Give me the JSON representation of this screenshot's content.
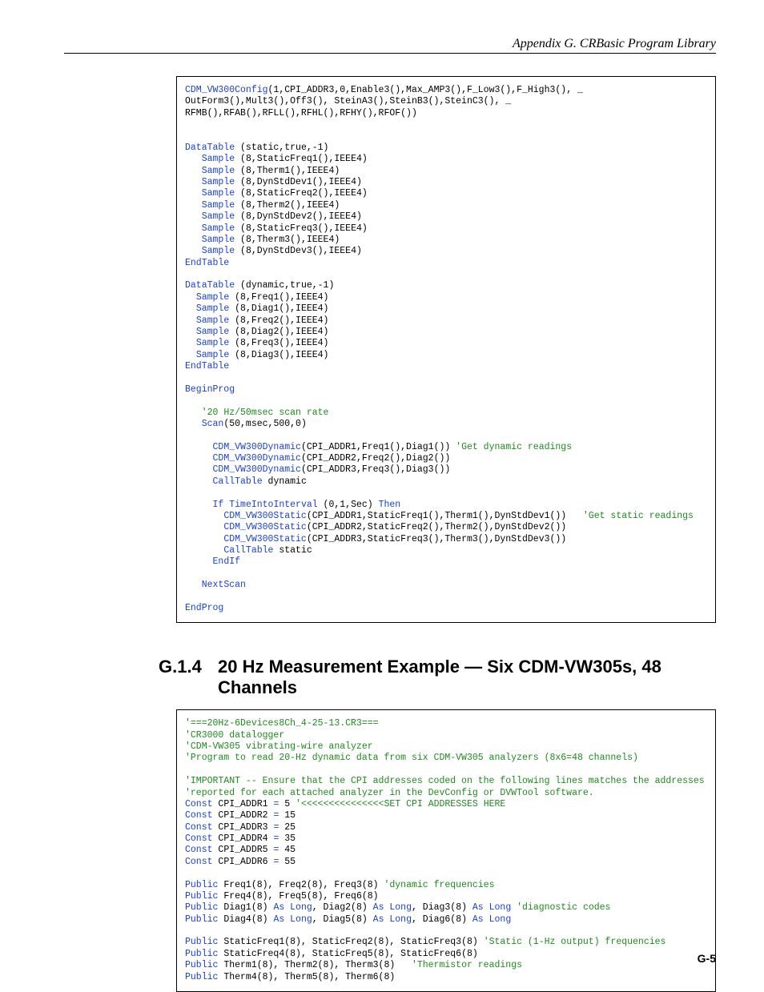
{
  "runningHead": "Appendix G.  CRBasic Program Library",
  "pageNumber": "G-5",
  "section": {
    "number": "G.1.4",
    "title": "20 Hz Measurement Example — Six CDM-VW305s, 48 Channels"
  },
  "code1": [
    [
      [
        "kw",
        "CDM_VW300Config"
      ],
      [
        "plain",
        "(1,CPI_ADDR3,0,Enable3(),Max_AMP3(),F_Low3(),F_High3(), _"
      ]
    ],
    [
      [
        "plain",
        "OutForm3(),Mult3(),Off3(), SteinA3(),SteinB3(),SteinC3(), _"
      ]
    ],
    [
      [
        "plain",
        "RFMB(),RFAB(),RFLL(),RFHL(),RFHY(),RFOF())"
      ]
    ],
    [],
    [],
    [
      [
        "kw",
        "DataTable"
      ],
      [
        "plain",
        " (static,true,-1)"
      ]
    ],
    [
      [
        "plain",
        "   "
      ],
      [
        "kw",
        "Sample"
      ],
      [
        "plain",
        " (8,StaticFreq1(),IEEE4)"
      ]
    ],
    [
      [
        "plain",
        "   "
      ],
      [
        "kw",
        "Sample"
      ],
      [
        "plain",
        " (8,Therm1(),IEEE4)"
      ]
    ],
    [
      [
        "plain",
        "   "
      ],
      [
        "kw",
        "Sample"
      ],
      [
        "plain",
        " (8,DynStdDev1(),IEEE4)"
      ]
    ],
    [
      [
        "plain",
        "   "
      ],
      [
        "kw",
        "Sample"
      ],
      [
        "plain",
        " (8,StaticFreq2(),IEEE4)"
      ]
    ],
    [
      [
        "plain",
        "   "
      ],
      [
        "kw",
        "Sample"
      ],
      [
        "plain",
        " (8,Therm2(),IEEE4)"
      ]
    ],
    [
      [
        "plain",
        "   "
      ],
      [
        "kw",
        "Sample"
      ],
      [
        "plain",
        " (8,DynStdDev2(),IEEE4)"
      ]
    ],
    [
      [
        "plain",
        "   "
      ],
      [
        "kw",
        "Sample"
      ],
      [
        "plain",
        " (8,StaticFreq3(),IEEE4)"
      ]
    ],
    [
      [
        "plain",
        "   "
      ],
      [
        "kw",
        "Sample"
      ],
      [
        "plain",
        " (8,Therm3(),IEEE4)"
      ]
    ],
    [
      [
        "plain",
        "   "
      ],
      [
        "kw",
        "Sample"
      ],
      [
        "plain",
        " (8,DynStdDev3(),IEEE4)"
      ]
    ],
    [
      [
        "kw",
        "EndTable"
      ]
    ],
    [],
    [
      [
        "kw",
        "DataTable"
      ],
      [
        "plain",
        " (dynamic,true,-1)"
      ]
    ],
    [
      [
        "plain",
        "  "
      ],
      [
        "kw",
        "Sample"
      ],
      [
        "plain",
        " (8,Freq1(),IEEE4)"
      ]
    ],
    [
      [
        "plain",
        "  "
      ],
      [
        "kw",
        "Sample"
      ],
      [
        "plain",
        " (8,Diag1(),IEEE4)"
      ]
    ],
    [
      [
        "plain",
        "  "
      ],
      [
        "kw",
        "Sample"
      ],
      [
        "plain",
        " (8,Freq2(),IEEE4)"
      ]
    ],
    [
      [
        "plain",
        "  "
      ],
      [
        "kw",
        "Sample"
      ],
      [
        "plain",
        " (8,Diag2(),IEEE4)"
      ]
    ],
    [
      [
        "plain",
        "  "
      ],
      [
        "kw",
        "Sample"
      ],
      [
        "plain",
        " (8,Freq3(),IEEE4)"
      ]
    ],
    [
      [
        "plain",
        "  "
      ],
      [
        "kw",
        "Sample"
      ],
      [
        "plain",
        " (8,Diag3(),IEEE4)"
      ]
    ],
    [
      [
        "kw",
        "EndTable"
      ]
    ],
    [],
    [
      [
        "kw",
        "BeginProg"
      ]
    ],
    [],
    [
      [
        "plain",
        "   "
      ],
      [
        "cm",
        "'20 Hz/50msec scan rate"
      ]
    ],
    [
      [
        "plain",
        "   "
      ],
      [
        "kw",
        "Scan"
      ],
      [
        "plain",
        "(50,msec,500,0)"
      ]
    ],
    [],
    [
      [
        "plain",
        "     "
      ],
      [
        "kw",
        "CDM_VW300Dynamic"
      ],
      [
        "plain",
        "(CPI_ADDR1,Freq1(),Diag1()) "
      ],
      [
        "cm",
        "'Get dynamic readings"
      ]
    ],
    [
      [
        "plain",
        "     "
      ],
      [
        "kw",
        "CDM_VW300Dynamic"
      ],
      [
        "plain",
        "(CPI_ADDR2,Freq2(),Diag2())"
      ]
    ],
    [
      [
        "plain",
        "     "
      ],
      [
        "kw",
        "CDM_VW300Dynamic"
      ],
      [
        "plain",
        "(CPI_ADDR3,Freq3(),Diag3())"
      ]
    ],
    [
      [
        "plain",
        "     "
      ],
      [
        "kw",
        "CallTable"
      ],
      [
        "plain",
        " dynamic"
      ]
    ],
    [],
    [
      [
        "plain",
        "     "
      ],
      [
        "kw",
        "If"
      ],
      [
        "plain",
        " "
      ],
      [
        "kw",
        "TimeIntoInterval"
      ],
      [
        "plain",
        " (0,1,Sec) "
      ],
      [
        "kw",
        "Then"
      ]
    ],
    [
      [
        "plain",
        "       "
      ],
      [
        "kw",
        "CDM_VW300Static"
      ],
      [
        "plain",
        "(CPI_ADDR1,StaticFreq1(),Therm1(),DynStdDev1())   "
      ],
      [
        "cm",
        "'Get static readings"
      ]
    ],
    [
      [
        "plain",
        "       "
      ],
      [
        "kw",
        "CDM_VW300Static"
      ],
      [
        "plain",
        "(CPI_ADDR2,StaticFreq2(),Therm2(),DynStdDev2())"
      ]
    ],
    [
      [
        "plain",
        "       "
      ],
      [
        "kw",
        "CDM_VW300Static"
      ],
      [
        "plain",
        "(CPI_ADDR3,StaticFreq3(),Therm3(),DynStdDev3())"
      ]
    ],
    [
      [
        "plain",
        "       "
      ],
      [
        "kw",
        "CallTable"
      ],
      [
        "plain",
        " static"
      ]
    ],
    [
      [
        "plain",
        "     "
      ],
      [
        "kw",
        "EndIf"
      ]
    ],
    [],
    [
      [
        "plain",
        "   "
      ],
      [
        "kw",
        "NextScan"
      ]
    ],
    [],
    [
      [
        "kw",
        "EndProg"
      ]
    ]
  ],
  "code2": [
    [
      [
        "cm",
        "'===20Hz-6Devices8Ch_4-25-13.CR3==="
      ]
    ],
    [
      [
        "cm",
        "'CR3000 datalogger"
      ]
    ],
    [
      [
        "cm",
        "'CDM-VW305 vibrating-wire analyzer"
      ]
    ],
    [
      [
        "cm",
        "'Program to read 20-Hz dynamic data from six CDM-VW305 analyzers (8x6=48 channels)"
      ]
    ],
    [],
    [
      [
        "cm",
        "'IMPORTANT -- Ensure that the CPI addresses coded on the following lines matches the addresses"
      ]
    ],
    [
      [
        "cm",
        "'reported for each attached analyzer in the DevConfig or DVWTool software."
      ]
    ],
    [
      [
        "kw",
        "Const"
      ],
      [
        "plain",
        " CPI_ADDR1 "
      ],
      [
        "kw",
        "="
      ],
      [
        "plain",
        " 5 "
      ],
      [
        "cm",
        "'<<<<<<<<<<<<<<<SET CPI ADDRESSES HERE"
      ]
    ],
    [
      [
        "kw",
        "Const"
      ],
      [
        "plain",
        " CPI_ADDR2 "
      ],
      [
        "kw",
        "="
      ],
      [
        "plain",
        " 15"
      ]
    ],
    [
      [
        "kw",
        "Const"
      ],
      [
        "plain",
        " CPI_ADDR3 "
      ],
      [
        "kw",
        "="
      ],
      [
        "plain",
        " 25"
      ]
    ],
    [
      [
        "kw",
        "Const"
      ],
      [
        "plain",
        " CPI_ADDR4 "
      ],
      [
        "kw",
        "="
      ],
      [
        "plain",
        " 35"
      ]
    ],
    [
      [
        "kw",
        "Const"
      ],
      [
        "plain",
        " CPI_ADDR5 "
      ],
      [
        "kw",
        "="
      ],
      [
        "plain",
        " 45"
      ]
    ],
    [
      [
        "kw",
        "Const"
      ],
      [
        "plain",
        " CPI_ADDR6 "
      ],
      [
        "kw",
        "="
      ],
      [
        "plain",
        " 55"
      ]
    ],
    [],
    [
      [
        "kw",
        "Public"
      ],
      [
        "plain",
        " Freq1(8), Freq2(8), Freq3(8) "
      ],
      [
        "cm",
        "'dynamic frequencies"
      ]
    ],
    [
      [
        "kw",
        "Public"
      ],
      [
        "plain",
        " Freq4(8), Freq5(8), Freq6(8)"
      ]
    ],
    [
      [
        "kw",
        "Public"
      ],
      [
        "plain",
        " Diag1(8) "
      ],
      [
        "kw",
        "As Long"
      ],
      [
        "plain",
        ", Diag2(8) "
      ],
      [
        "kw",
        "As Long"
      ],
      [
        "plain",
        ", Diag3(8) "
      ],
      [
        "kw",
        "As Long"
      ],
      [
        "plain",
        " "
      ],
      [
        "cm",
        "'diagnostic codes"
      ]
    ],
    [
      [
        "kw",
        "Public"
      ],
      [
        "plain",
        " Diag4(8) "
      ],
      [
        "kw",
        "As Long"
      ],
      [
        "plain",
        ", Diag5(8) "
      ],
      [
        "kw",
        "As Long"
      ],
      [
        "plain",
        ", Diag6(8) "
      ],
      [
        "kw",
        "As Long"
      ]
    ],
    [],
    [
      [
        "kw",
        "Public"
      ],
      [
        "plain",
        " StaticFreq1(8), StaticFreq2(8), StaticFreq3(8) "
      ],
      [
        "cm",
        "'Static (1-Hz output) frequencies"
      ]
    ],
    [
      [
        "kw",
        "Public"
      ],
      [
        "plain",
        " StaticFreq4(8), StaticFreq5(8), StaticFreq6(8)"
      ]
    ],
    [
      [
        "kw",
        "Public"
      ],
      [
        "plain",
        " Therm1(8), Therm2(8), Therm3(8)   "
      ],
      [
        "cm",
        "'Thermistor readings"
      ]
    ],
    [
      [
        "kw",
        "Public"
      ],
      [
        "plain",
        " Therm4(8), Therm5(8), Therm6(8)"
      ]
    ]
  ]
}
